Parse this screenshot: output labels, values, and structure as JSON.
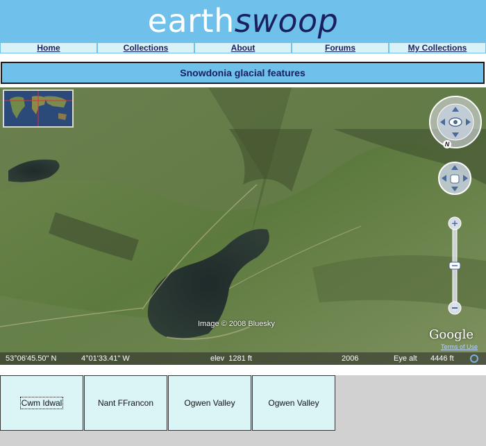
{
  "site": {
    "logo_part1": "earth",
    "logo_part2": "swoop"
  },
  "nav": [
    {
      "label": "Home"
    },
    {
      "label": "Collections"
    },
    {
      "label": "About"
    },
    {
      "label": "Forums"
    },
    {
      "label": "My Collections"
    }
  ],
  "collection_title": "Snowdonia glacial features",
  "map": {
    "copyright": "Image © 2008 Bluesky",
    "brand": "Google",
    "terms": "Terms of Use",
    "compass_letter": "N",
    "status": {
      "lat": "53°06'45.50\" N",
      "lon": "4°01'33.41\" W",
      "elev": "elev  1281 ft",
      "year": "2006",
      "eye_alt_label": "Eye alt",
      "eye_alt_value": "4446 ft"
    }
  },
  "tabs": [
    {
      "label": "Cwm Idwal",
      "selected": true
    },
    {
      "label": "Nant FFrancon",
      "selected": false
    },
    {
      "label": "Ogwen Valley",
      "selected": false
    },
    {
      "label": "Ogwen Valley",
      "selected": false
    }
  ]
}
